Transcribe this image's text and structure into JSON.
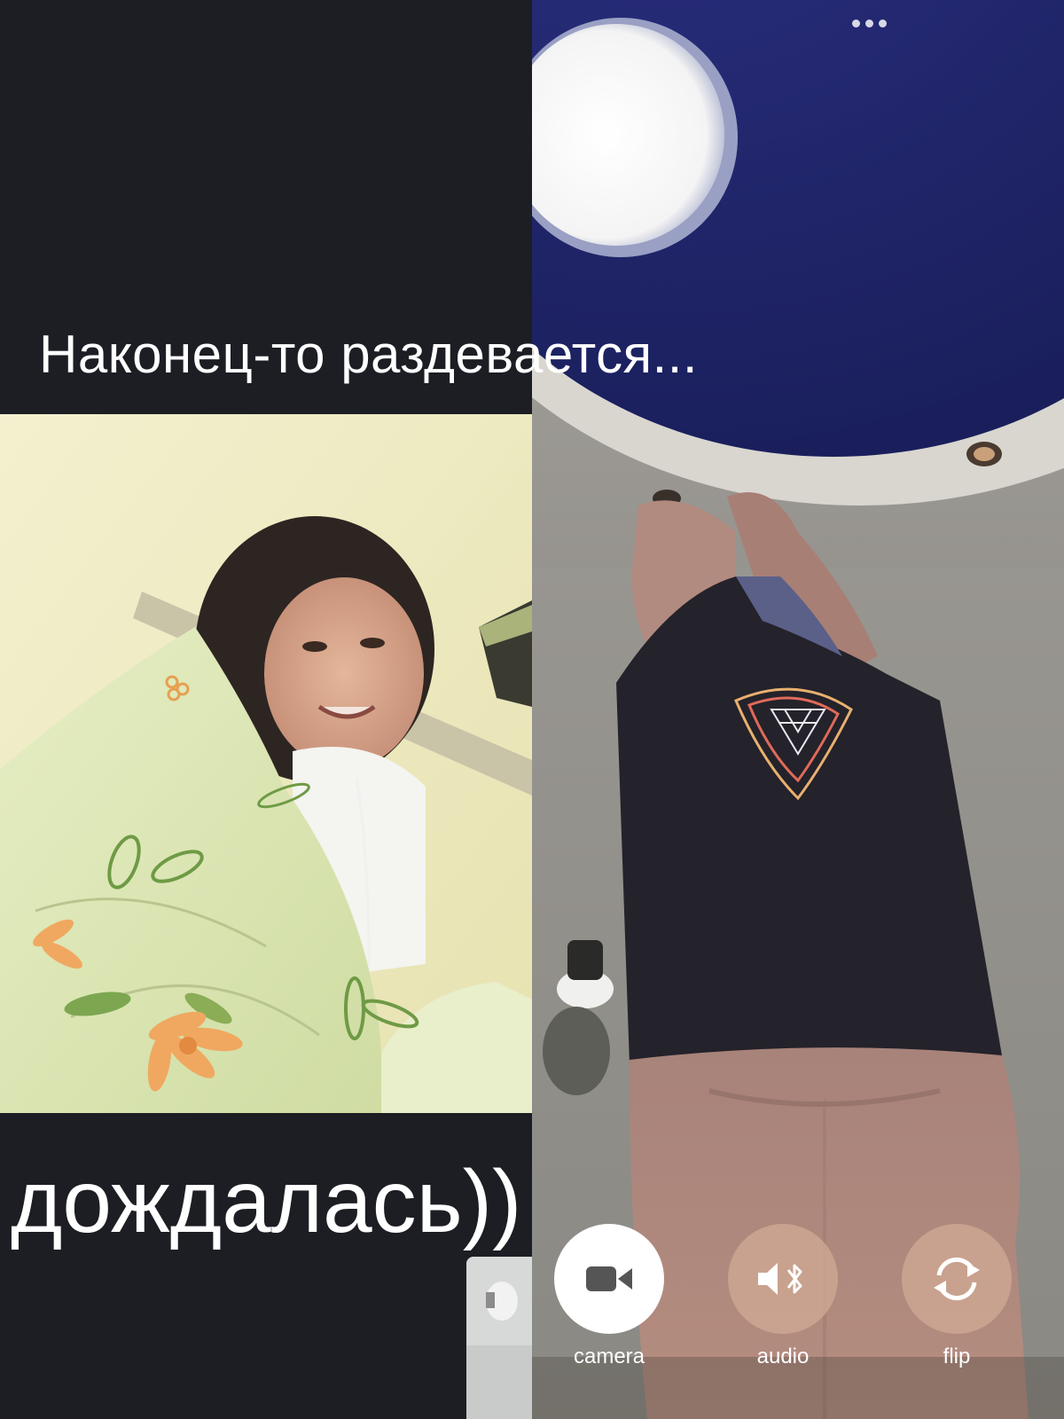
{
  "overlay": {
    "caption_top": "Наконец-то раздевается...",
    "caption_bottom": "дождалась))"
  },
  "call": {
    "controls": [
      {
        "id": "camera",
        "label": "camera",
        "icon": "video-camera-icon",
        "active": true
      },
      {
        "id": "audio",
        "label": "audio",
        "icon": "speaker-bluetooth-icon",
        "active": false
      },
      {
        "id": "flip",
        "label": "flip",
        "icon": "flip-camera-icon",
        "active": false
      }
    ],
    "menu_icon": "more-dots-icon"
  },
  "colors": {
    "panel_background": "#1c1e24",
    "caption_text": "#ffffff",
    "control_active_bg": "#ffffff",
    "control_inactive_bg": "#d2aa96",
    "control_icon_active": "#555555"
  }
}
